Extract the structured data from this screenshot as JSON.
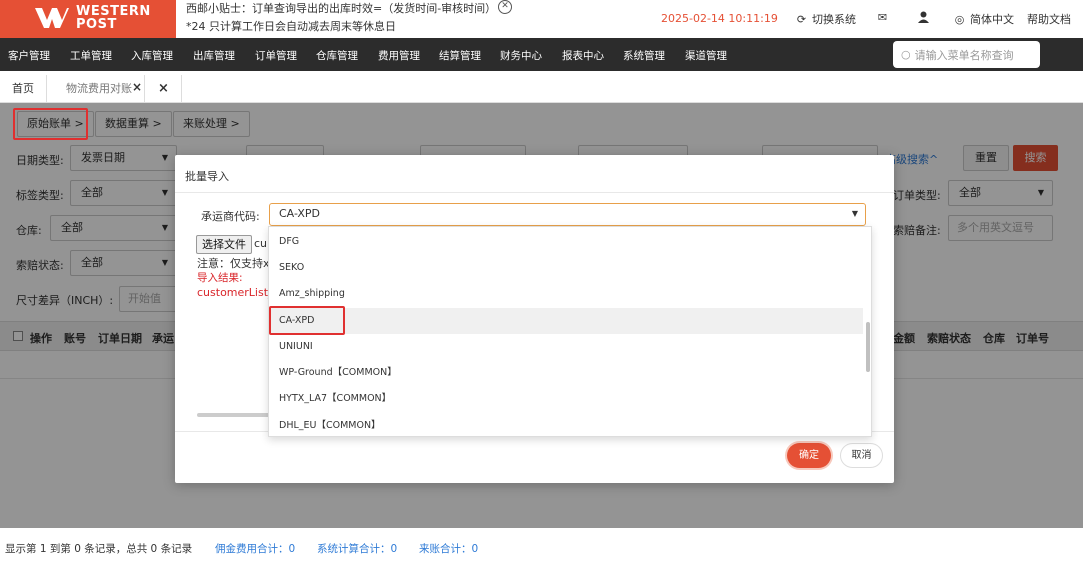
{
  "brand": {
    "line1": "WESTERN",
    "line2": "POST",
    "color": "#e55035"
  },
  "header": {
    "tip_line1": "西邮小贴士：订单查询导出的出库时效=（发货时间-审核时间）",
    "tip_line2": "*24 只计算工作日会自动减去周末等休息日",
    "datetime": "2025-02-14 10:11:19",
    "switch_system": "切换系统",
    "language": "简体中文",
    "help": "帮助文档"
  },
  "nav": {
    "items": [
      "客户管理",
      "工单管理",
      "入库管理",
      "出库管理",
      "订单管理",
      "仓库管理",
      "费用管理",
      "结算管理",
      "财务中心",
      "报表中心",
      "系统管理",
      "渠道管理"
    ],
    "search_placeholder": "请输入菜单名称查询"
  },
  "tabs": [
    "首页",
    "物流费用对账"
  ],
  "steps": [
    "原始账单 >",
    "数据重算 >",
    "来账处理 >"
  ],
  "filters": {
    "date_type_label": "日期类型:",
    "date_type_value": "发票日期",
    "tag_type_label": "标签类型:",
    "tag_type_value": "全部",
    "warehouse_label": "仓库:",
    "warehouse_value": "全部",
    "claim_status_label": "索赔状态:",
    "claim_status_value": "全部",
    "size_diff_label": "尺寸差异（INCH）:",
    "size_diff_placeholder": "开始值",
    "order_type_label": "订单类型:",
    "order_type_value": "全部",
    "claim_note_label": "索赔备注:",
    "claim_note_placeholder": "多个用英文逗号",
    "advanced": "高级搜索^",
    "reset": "重置",
    "search": "搜索"
  },
  "table": {
    "headers_left": [
      "操作",
      "账号",
      "订单日期",
      "承运"
    ],
    "headers_right": [
      "金额",
      "索赔状态",
      "仓库",
      "订单号"
    ]
  },
  "footer": {
    "records": "显示第 1 到第 0 条记录，总共 0 条记录",
    "commission": "佣金费用合计：0",
    "system_calc": "系统计算合计：0",
    "incoming": "来账合计：0"
  },
  "dialog": {
    "title": "批量导入",
    "carrier_label": "承运商代码:",
    "carrier_value": "CA-XPD",
    "file_button": "选择文件",
    "file_name": "cu",
    "note": "注意：仅支持xl",
    "import_result": "导入结果:",
    "import_file": "customerList_",
    "confirm": "确定",
    "cancel": "取消"
  },
  "dropdown": {
    "options": [
      "DFG",
      "SEKO",
      "Amz_shipping",
      "CA-XPD",
      "UNIUNI",
      "WP-Ground【COMMON】",
      "HYTX_LA7【COMMON】",
      "DHL_EU【COMMON】"
    ],
    "selected": "CA-XPD"
  }
}
